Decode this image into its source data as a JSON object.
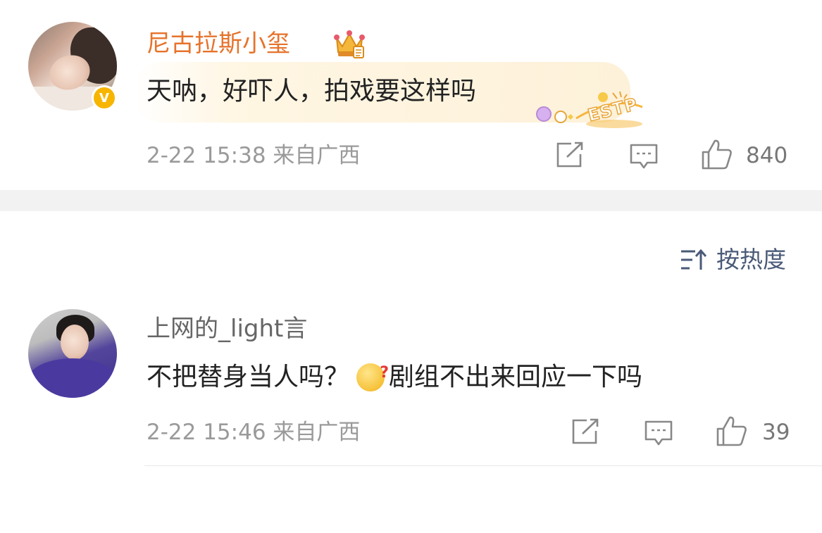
{
  "comment1": {
    "username": "尼古拉斯小玺",
    "badge_icon": "crown-icon",
    "verified_mark": "V",
    "text": "天呐，好吓人，拍戏要这样吗",
    "bubble_tag": "ESTP",
    "meta": "2-22 15:38 来自广西",
    "likes": "840"
  },
  "sort": {
    "label": "按热度"
  },
  "comment2": {
    "username": "上网的_light言",
    "text_before": "不把替身当人吗？",
    "emoji": "thinking-face-emoji",
    "emoji_mark": "?",
    "text_after": "剧组不出来回应一下吗",
    "meta": "2-22 15:46 来自广西",
    "likes": "39"
  },
  "colors": {
    "username_orange": "#e6732b",
    "verified_gold": "#f7b500",
    "meta_gray": "#9a9a9a",
    "sort_blue": "#4a5a78",
    "section_gap": "#f2f2f2"
  }
}
